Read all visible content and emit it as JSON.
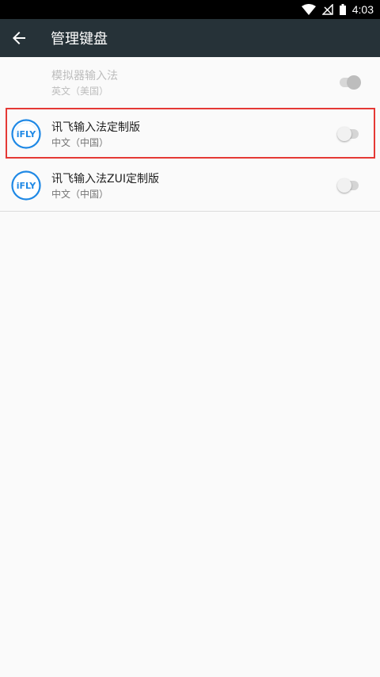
{
  "status_bar": {
    "time": "4:03",
    "icons": [
      "wifi-icon",
      "signal-off-icon",
      "battery-icon"
    ]
  },
  "app_bar": {
    "title": "管理键盘",
    "back_icon": "arrow-back-icon",
    "background": "#263238"
  },
  "keyboards": [
    {
      "title": "模拟器输入法",
      "subtitle": "英文（美国）",
      "enabled": true,
      "disabled": true,
      "logo": null
    },
    {
      "title": "讯飞输入法定制版",
      "subtitle": "中文（中国）",
      "enabled": false,
      "disabled": false,
      "logo": "iFLY"
    },
    {
      "title": "讯飞输入法ZUI定制版",
      "subtitle": "中文（中国）",
      "enabled": false,
      "disabled": false,
      "logo": "iFLY"
    }
  ],
  "colors": {
    "highlight": "#e53935",
    "logo_blue": "#1e88e5"
  }
}
